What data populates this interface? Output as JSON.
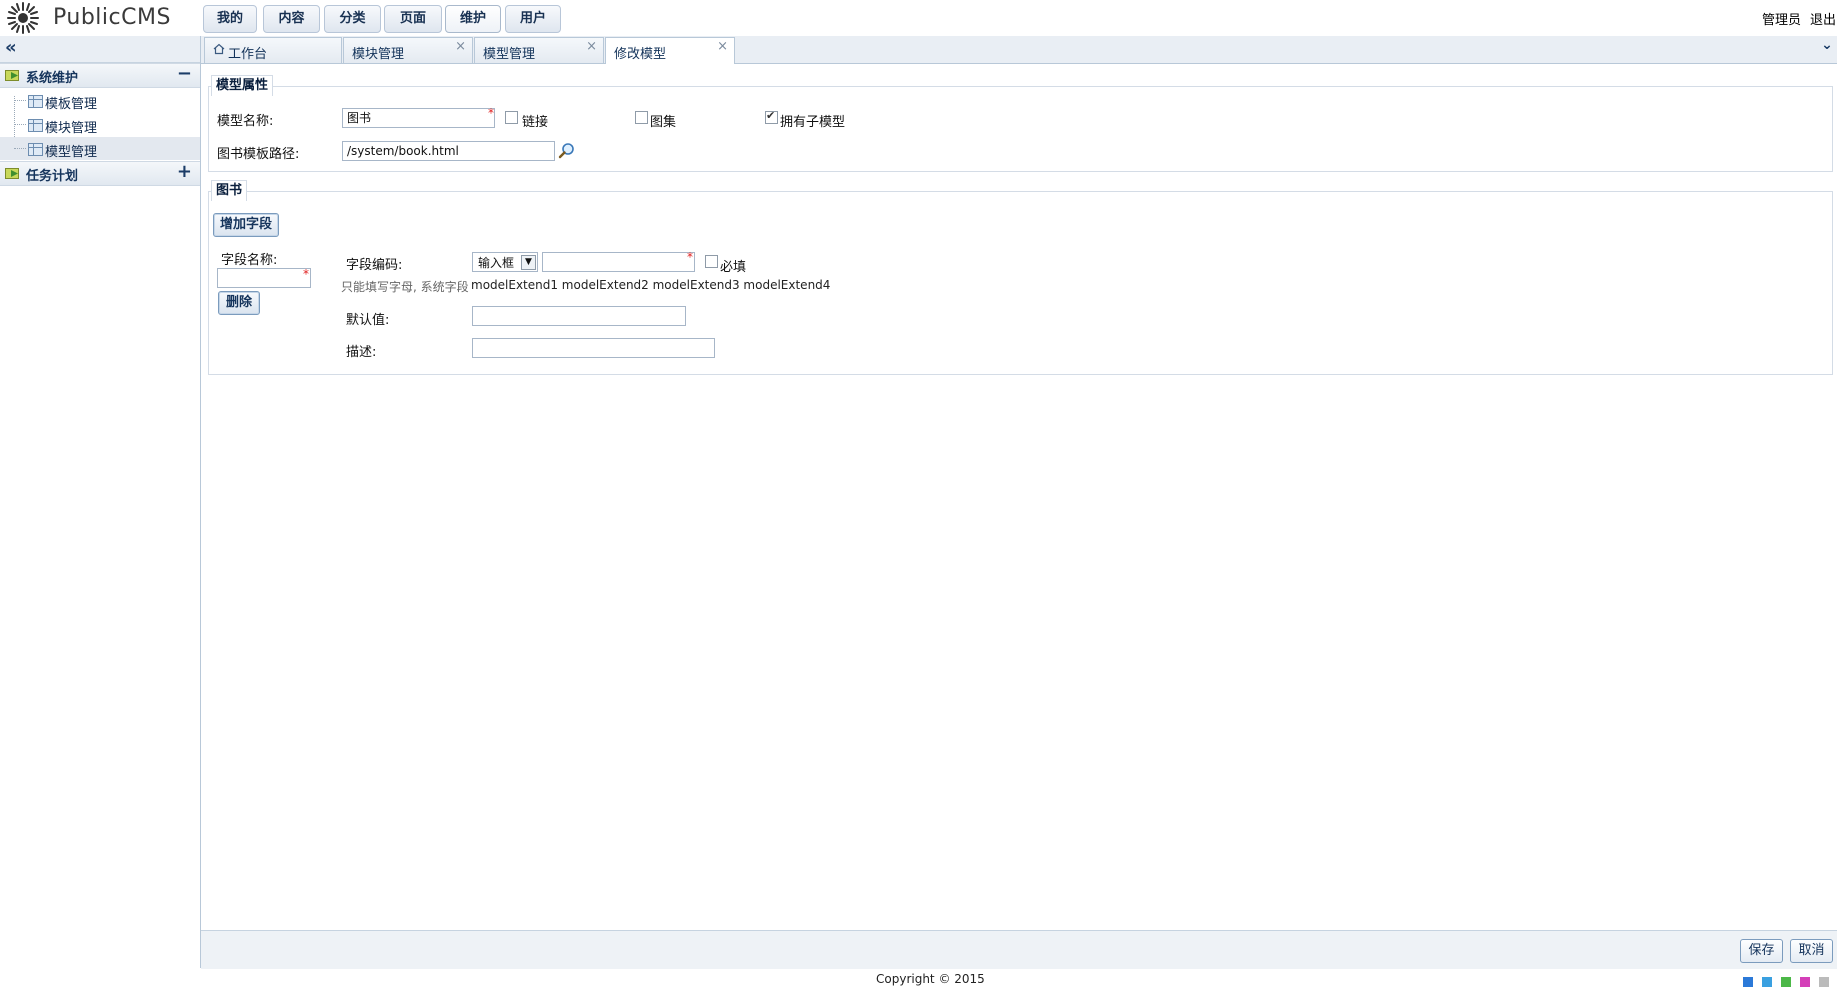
{
  "app": {
    "name": "PublicCMS"
  },
  "topnav": {
    "items": [
      {
        "label": "我的"
      },
      {
        "label": "内容"
      },
      {
        "label": "分类"
      },
      {
        "label": "页面"
      },
      {
        "label": "维护",
        "active": true
      },
      {
        "label": "用户"
      }
    ]
  },
  "user": {
    "name": "管理员",
    "logout": "退出"
  },
  "sidebar": {
    "collapse_icon": "double-chevron-left-icon",
    "groups": [
      {
        "label": "系统维护",
        "expanded": true,
        "toggle": "−",
        "items": [
          {
            "label": "模板管理"
          },
          {
            "label": "模块管理"
          },
          {
            "label": "模型管理",
            "selected": true
          }
        ]
      },
      {
        "label": "任务计划",
        "expanded": false,
        "toggle": "+"
      }
    ]
  },
  "tabs": [
    {
      "label": "工作台",
      "icon": "home-icon"
    },
    {
      "label": "模块管理",
      "close": "×"
    },
    {
      "label": "模型管理",
      "close": "×"
    },
    {
      "label": "修改模型",
      "close": "×",
      "active": true
    }
  ],
  "form": {
    "attrs_legend": "模型属性",
    "model_name_label": "模型名称:",
    "model_name_value": "图书",
    "required_mark": "*",
    "has_link_label": "链接",
    "has_link_checked": false,
    "has_images_label": "图集",
    "has_images_checked": false,
    "has_child_label": "拥有子模型",
    "has_child_checked": true,
    "template_path_label": "图书模板路径:",
    "template_path_value": "/system/book.html",
    "search_icon": "magnifier-icon",
    "fields_legend": "图书",
    "add_field_button": "增加字段",
    "field_name_label": "字段名称:",
    "field_name_value": "",
    "delete_button": "删除",
    "field_code_label": "字段编码:",
    "input_type_value": "输入框",
    "field_code_value": "",
    "required_label": "必填",
    "required_checked": false,
    "hint_text": "只能填写字母, 系统字段",
    "hint_fields": "modelExtend1 modelExtend2 modelExtend3 modelExtend4",
    "default_label": "默认值:",
    "default_value": "",
    "description_label": "描述:",
    "description_value": ""
  },
  "footer": {
    "save": "保存",
    "cancel": "取消",
    "copyright": "Copyright © 2015",
    "theme_colors": [
      "#2b79d8",
      "#3aa0e0",
      "#4cb848",
      "#d43fb8",
      "#bbbbbb"
    ]
  }
}
